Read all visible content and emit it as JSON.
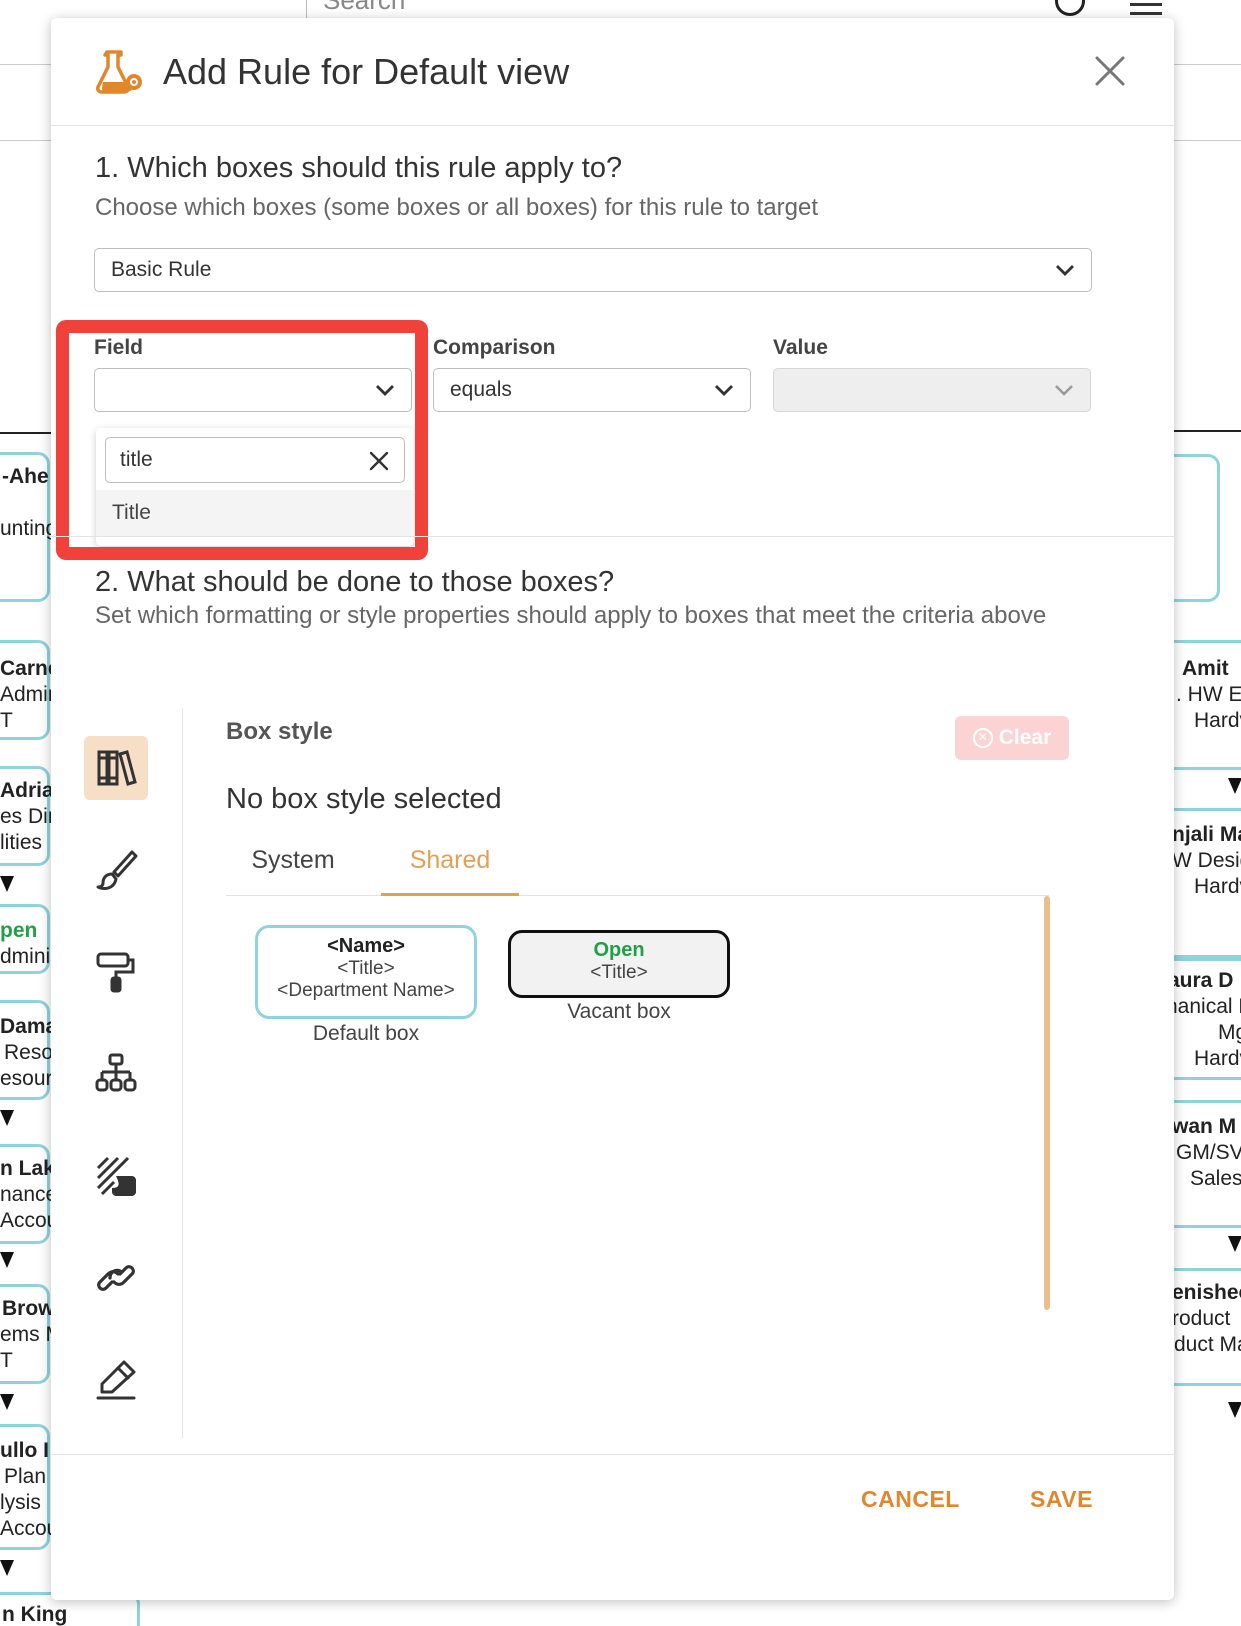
{
  "background": {
    "search_placeholder": "Search",
    "left_fragments": [
      {
        "name": "-Ahe",
        "sub": "unting"
      },
      {
        "name": "Carne",
        "sub": "Admin",
        "sub2": "T"
      },
      {
        "name": "Adria",
        "sub": "es Dir",
        "sub2": "lities"
      },
      {
        "name": "pen",
        "sub": "dminis",
        "green": true
      },
      {
        "name": "Dama",
        "sub": "Reso",
        "sub2": "esour"
      },
      {
        "name": "n Lak",
        "sub": "nance",
        "sub2": "Accou"
      },
      {
        "name": "Brow",
        "sub": "ems M",
        "sub2": "T"
      },
      {
        "name": "ullo I",
        "sub": "Plan",
        "sub2": "lysis",
        "sub3": "Accou"
      },
      {
        "name": "n King"
      }
    ],
    "right_fragments": [
      {
        "name": "Amit",
        "sub": ". HW En",
        "sub2": "Hardv"
      },
      {
        "name": "njali Ma",
        "sub": "W Desig",
        "sub2": "Hardv"
      },
      {
        "name": "aura D",
        "sub": "nanical E",
        "sub2": "Mg",
        "sub3": "Hardv"
      },
      {
        "name": "wan M",
        "sub": "GM/SVI",
        "sub2": "Sales"
      },
      {
        "name": "enishec",
        "sub": "roduct",
        "sub2": "duct Ma"
      }
    ]
  },
  "modal": {
    "title": "Add Rule for Default view",
    "section1": {
      "title": "1. Which boxes should this rule apply to?",
      "subtitle": "Choose which boxes (some boxes or all boxes) for this rule to target",
      "rule_type": "Basic Rule",
      "field_label": "Field",
      "field_value": "",
      "field_search": "title",
      "field_option": "Title",
      "comparison_label": "Comparison",
      "comparison_value": "equals",
      "value_label": "Value",
      "value_value": ""
    },
    "section2": {
      "title": "2. What should be done to those boxes?",
      "subtitle": "Set which formatting or style properties should apply to boxes that meet the criteria above"
    },
    "rail_icons": [
      "books-icon",
      "brush-icon",
      "paint-roller-icon",
      "hierarchy-icon",
      "pattern-icon",
      "link-icon",
      "pen-icon"
    ],
    "box_style": {
      "label": "Box style",
      "clear_label": "Clear",
      "none_selected": "No box style selected",
      "tabs": [
        "System",
        "Shared"
      ],
      "active_tab": "Shared",
      "styles": [
        {
          "line1": "<Name>",
          "line2": "<Title>",
          "line3": "<Department Name>",
          "caption": "Default box"
        },
        {
          "line1": "Open",
          "line2": "<Title>",
          "caption": "Vacant box"
        }
      ]
    },
    "footer": {
      "cancel": "CANCEL",
      "save": "SAVE"
    }
  },
  "colors": {
    "accent": "#e0872e",
    "highlight": "#f0413a",
    "card_border": "#8fd3dd",
    "open_green": "#22a046"
  }
}
